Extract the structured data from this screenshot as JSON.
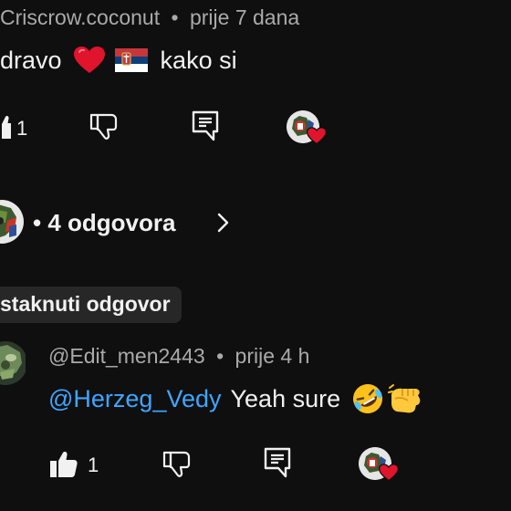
{
  "comment": {
    "author": "Criscrow.coconut",
    "separator": "•",
    "time": "prije 7 dana",
    "text_prefix": "dravo",
    "emoji_heart": "❤️",
    "text_suffix": "kako si",
    "like_count": "1"
  },
  "replies_toggle": {
    "label": "• 4 odgovora",
    "chevron": "›"
  },
  "highlighted_reply": {
    "badge": "staknuti odgovor",
    "author": "@Edit_men2443",
    "separator": "•",
    "time": "prije 4 h",
    "mention": "@Herzeg_Vedy",
    "text": "Yeah sure",
    "emojis": "🤣👊",
    "like_count": "1"
  },
  "colors": {
    "background": "#0f0f0f",
    "meta_text": "#aaaaaa",
    "link": "#3ea6ff",
    "heart": "#e0142c",
    "badge_bg": "#272727"
  }
}
